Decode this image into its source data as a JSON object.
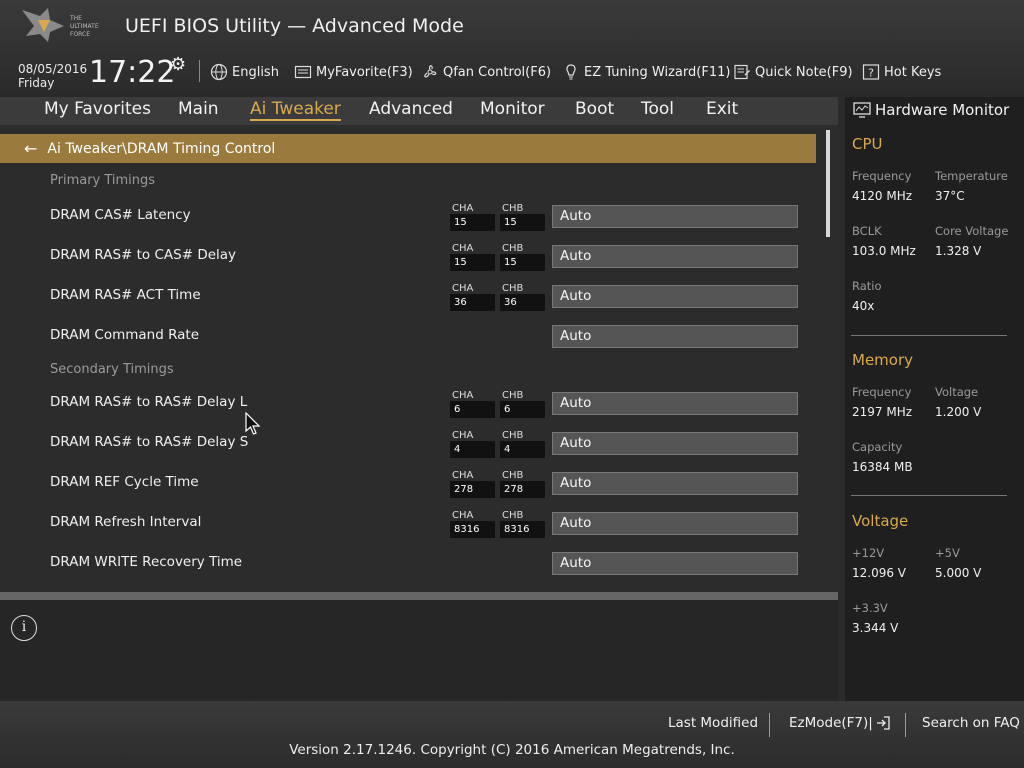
{
  "header": {
    "logo_text": [
      "THE",
      "ULTIMATE",
      "FORCE"
    ],
    "title": "UEFI BIOS Utility — Advanced Mode",
    "date": "08/05/2016",
    "day": "Friday",
    "time": "17:22",
    "toolbar": [
      {
        "label": "English",
        "icon": "globe-icon"
      },
      {
        "label": "MyFavorite(F3)",
        "icon": "favorite-icon"
      },
      {
        "label": "Qfan Control(F6)",
        "icon": "fan-icon"
      },
      {
        "label": "EZ Tuning Wizard(F11)",
        "icon": "bulb-icon"
      },
      {
        "label": "Quick Note(F9)",
        "icon": "note-icon"
      },
      {
        "label": "Hot Keys",
        "icon": "question-icon"
      }
    ]
  },
  "menu": [
    "My Favorites",
    "Main",
    "Ai Tweaker",
    "Advanced",
    "Monitor",
    "Boot",
    "Tool",
    "Exit"
  ],
  "active_menu": "Ai Tweaker",
  "breadcrumb": "Ai Tweaker\\DRAM Timing Control",
  "sections": {
    "primary": "Primary Timings",
    "secondary": "Secondary Timings"
  },
  "channel_labels": {
    "a": "CHA",
    "b": "CHB"
  },
  "rows": [
    {
      "label": "DRAM CAS# Latency",
      "cha": "15",
      "chb": "15",
      "value": "Auto"
    },
    {
      "label": "DRAM RAS# to CAS# Delay",
      "cha": "15",
      "chb": "15",
      "value": "Auto"
    },
    {
      "label": "DRAM RAS# ACT Time",
      "cha": "36",
      "chb": "36",
      "value": "Auto"
    },
    {
      "label": "DRAM Command Rate",
      "cha": null,
      "chb": null,
      "value": "Auto"
    },
    {
      "label": "DRAM RAS# to RAS# Delay L",
      "cha": "6",
      "chb": "6",
      "value": "Auto"
    },
    {
      "label": "DRAM RAS# to RAS# Delay S",
      "cha": "4",
      "chb": "4",
      "value": "Auto"
    },
    {
      "label": "DRAM REF Cycle Time",
      "cha": "278",
      "chb": "278",
      "value": "Auto"
    },
    {
      "label": "DRAM Refresh Interval",
      "cha": "8316",
      "chb": "8316",
      "value": "Auto"
    },
    {
      "label": "DRAM WRITE Recovery Time",
      "cha": null,
      "chb": null,
      "value": "Auto"
    }
  ],
  "hw_monitor": {
    "title": "Hardware Monitor",
    "cpu": {
      "title": "CPU",
      "frequency_label": "Frequency",
      "frequency": "4120 MHz",
      "temperature_label": "Temperature",
      "temperature": "37°C",
      "bclk_label": "BCLK",
      "bclk": "103.0 MHz",
      "core_voltage_label": "Core Voltage",
      "core_voltage": "1.328 V",
      "ratio_label": "Ratio",
      "ratio": "40x"
    },
    "memory": {
      "title": "Memory",
      "frequency_label": "Frequency",
      "frequency": "2197 MHz",
      "voltage_label": "Voltage",
      "voltage": "1.200 V",
      "capacity_label": "Capacity",
      "capacity": "16384 MB"
    },
    "voltage": {
      "title": "Voltage",
      "v12_label": "+12V",
      "v12": "12.096 V",
      "v5_label": "+5V",
      "v5": "5.000 V",
      "v33_label": "+3.3V",
      "v33": "3.344 V"
    }
  },
  "footer": {
    "last_modified": "Last Modified",
    "ezmode": "EzMode(F7)|",
    "search": "Search on FAQ",
    "copyright": "Version 2.17.1246. Copyright (C) 2016 American Megatrends, Inc."
  },
  "colors": {
    "accent": "#d8a94e",
    "breadcrumb_bg": "#9a7a3d"
  }
}
